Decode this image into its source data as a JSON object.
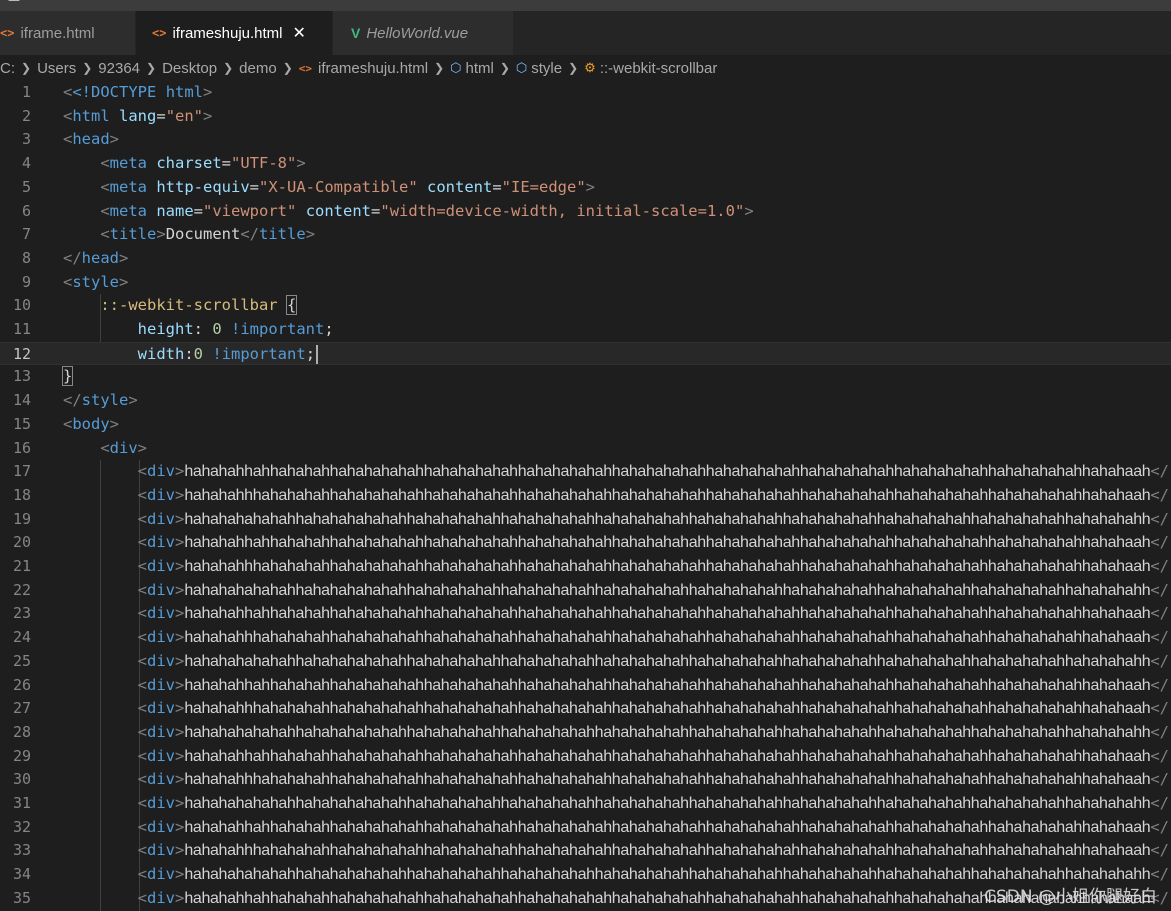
{
  "tabs": [
    {
      "label": "iframe.html",
      "icon": "html-file-icon",
      "active": false
    },
    {
      "label": "iframeshuju.html",
      "icon": "html-file-icon",
      "active": true
    },
    {
      "label": "HelloWorld.vue",
      "icon": "vue-file-icon",
      "active": false
    }
  ],
  "breadcrumb": [
    "C:",
    "Users",
    "92364",
    "Desktop",
    "demo",
    "iframeshuju.html",
    "html",
    "style",
    "::-webkit-scrollbar"
  ],
  "editor": {
    "current_line": 12,
    "lines": [
      {
        "n": "1"
      },
      {
        "n": "2"
      },
      {
        "n": "3"
      },
      {
        "n": "4"
      },
      {
        "n": "5"
      },
      {
        "n": "6"
      },
      {
        "n": "7"
      },
      {
        "n": "8"
      },
      {
        "n": "9"
      },
      {
        "n": "10"
      },
      {
        "n": "11"
      },
      {
        "n": "12"
      },
      {
        "n": "13"
      },
      {
        "n": "14"
      },
      {
        "n": "15"
      },
      {
        "n": "16"
      },
      {
        "n": "17",
        "text": "hahahahhahhahahahhahahahahahhahahahahahhahahahahahhahahahahahhahahahahahhahahahahahhahahahahahhahahahahahhahahaah"
      },
      {
        "n": "18",
        "text": "hahahahhhahahahahhahahahahahhahahahahahhahahahahahhahahahahahhahahahahahhahahahahahhahahahahahhahahahahahhahahaah"
      },
      {
        "n": "19",
        "text": "hahahahahahahhahahahahahahhahahahahahhahahahahahhahahahahahhahahahahahhahahahahahhahahahahahhahahahahahhahahahahh"
      },
      {
        "n": "20",
        "text": "hahahahhahhahahahhahahahahahhahahahahahhahahahahahhahahahahahhahahahahahhahahahahahhahahahahahhahahahahahhahahaah"
      },
      {
        "n": "21",
        "text": "hahahahhhahahahahhahahahahahhahahahahahhahahahahahhahahahahahhahahahahahhahahahahahhahahahahahhahahahahahhahahaah"
      },
      {
        "n": "22",
        "text": "hahahahahahahhahahahahahahhahahahahahhahahahahahhahahahahahhahahahahahhahahahahahhahahahahahhahahahahahhahahahahh"
      },
      {
        "n": "23",
        "text": "hahahahhahhahahahhahahahahahhahahahahahhahahahahahhahahahahahhahahahahahhahahahahahhahahahahahhahahahahahhahahaah"
      },
      {
        "n": "24",
        "text": "hahahahhhahahahahhahahahahahhahahahahahhahahahahahhahahahahahhahahahahahhahahahahahhahahahahahhahahahahahhahahaah"
      },
      {
        "n": "25",
        "text": "hahahahahahahhahahahahahahhahahahahahhahahahahahhahahahahahhahahahahahhahahahahahhahahahahahhahahahahahhahahahahh"
      },
      {
        "n": "26",
        "text": "hahahahhahhahahahhahahahahahhahahahahahhahahahahahhahahahahahhahahahahahhahahahahahhahahahahahhahahahahahhahahaah"
      },
      {
        "n": "27",
        "text": "hahahahhhahahahahhahahahahahhahahahahahhahahahahahhahahahahahhahahahahahhahahahahahhahahahahahhahahahahahhahahaah"
      },
      {
        "n": "28",
        "text": "hahahahahahahhahahahahahahhahahahahahhahahahahahhahahahahahhahahahahahhahahahahahhahahahahahhahahahahahhahahahahh"
      },
      {
        "n": "29",
        "text": "hahahahhahhahahahhahahahahahhahahahahahhahahahahahhahahahahahhahahahahahhahahahahahhahahahahahhahahahahahhahahaah"
      },
      {
        "n": "30",
        "text": "hahahahhhahahahahhahahahahahhahahahahahhahahahahahhahahahahahhahahahahahhahahahahahhahahahahahhahahahahahhahahaah"
      },
      {
        "n": "31",
        "text": "hahahahahahahhahahahahahahhahahahahahhahahahahahhahahahahahhahahahahahhahahahahahhahahahahahhahahahahahhahahahahh"
      },
      {
        "n": "32",
        "text": "hahahahhahhahahahhahahahahahhahahahahahhahahahahahhahahahahahhahahahahahhahahahahahhahahahahahhahahahahahhahahaah"
      },
      {
        "n": "33",
        "text": "hahahahhhahahahahhahahahahahhahahahahahhahahahahahhahahahahahhahahahahahhahahahahahhahahahahahhahahahahahhahahaah"
      },
      {
        "n": "34",
        "text": "hahahahahahahhahahahahahahhahahahahahhahahahahahhahahahahahhahahahahahhahahahahahhahahahahahhahahahahahhahahahahh"
      },
      {
        "n": "35",
        "text": "hahahahhahhahahahhahahahahahhahahahahahhahahahahahhahahahahahhahahahahahhahahahahahhahahahahahhahahahahahhahahaah"
      }
    ]
  },
  "code": {
    "doctype": "<!DOCTYPE",
    "html_kw": "html",
    "lang_val": "\"en\"",
    "charset_val": "\"UTF-8\"",
    "http_equiv_val": "\"X-UA-Compatible\"",
    "ie_val": "\"IE=edge\"",
    "viewport_val": "\"viewport\"",
    "viewport_content": "\"width=device-width, initial-scale=1.0\"",
    "title_text": "Document",
    "selector": "::-webkit-scrollbar",
    "prop_height": "height",
    "prop_width": "width",
    "zero": "0",
    "important": "!important"
  },
  "watermark": "CSDN @小姐你腿好白"
}
